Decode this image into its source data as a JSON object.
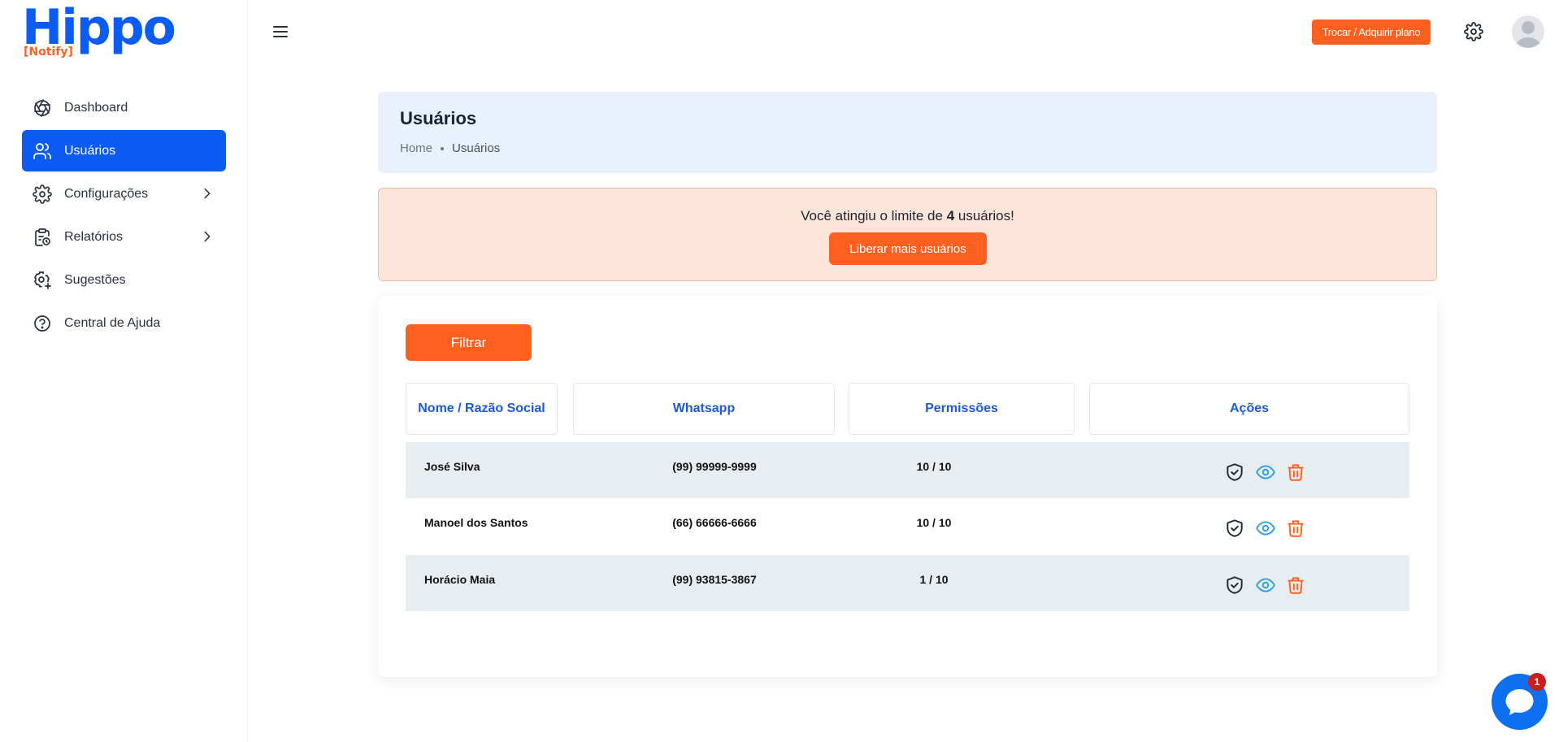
{
  "brand": {
    "logo_text": "Hippo",
    "logo_sub": "[Notify]",
    "primary": "#0b5bf5",
    "accent": "#ff5f1f"
  },
  "sidebar": {
    "items": [
      {
        "label": "Dashboard",
        "icon": "aperture-icon",
        "active": false,
        "has_submenu": false
      },
      {
        "label": "Usuários",
        "icon": "users-icon",
        "active": true,
        "has_submenu": false
      },
      {
        "label": "Configurações",
        "icon": "gear-icon",
        "active": false,
        "has_submenu": true
      },
      {
        "label": "Relatórios",
        "icon": "clipboard-clock-icon",
        "active": false,
        "has_submenu": true
      },
      {
        "label": "Sugestões",
        "icon": "gear-plus-icon",
        "active": false,
        "has_submenu": false
      },
      {
        "label": "Central de Ajuda",
        "icon": "help-circle-icon",
        "active": false,
        "has_submenu": false
      }
    ]
  },
  "topbar": {
    "menu_icon": "hamburger-icon",
    "plan_button": "Trocar / Adquirir plano",
    "settings_icon": "gear-icon",
    "avatar_icon": "user-avatar-icon"
  },
  "header": {
    "title": "Usuários",
    "breadcrumb": [
      "Home",
      "Usuários"
    ]
  },
  "alert": {
    "text_before": "Você atingiu o limite de ",
    "limit": "4",
    "text_after": " usuários!",
    "button": "Liberar mais usuários"
  },
  "table": {
    "filter_button": "Filtrar",
    "columns": [
      "Nome / Razão Social",
      "Whatsapp",
      "Permissões",
      "Ações"
    ],
    "rows": [
      {
        "name": "José Silva",
        "whatsapp": "(99) 99999-9999",
        "permissions": "10 / 10"
      },
      {
        "name": "Manoel dos Santos",
        "whatsapp": "(66) 66666-6666",
        "permissions": "10 / 10"
      },
      {
        "name": "Horácio Maia",
        "whatsapp": "(99) 93815-3867",
        "permissions": "1 / 10"
      }
    ],
    "actions": [
      "shield-check-icon",
      "eye-icon",
      "trash-icon"
    ]
  },
  "chat": {
    "badge": "1"
  }
}
